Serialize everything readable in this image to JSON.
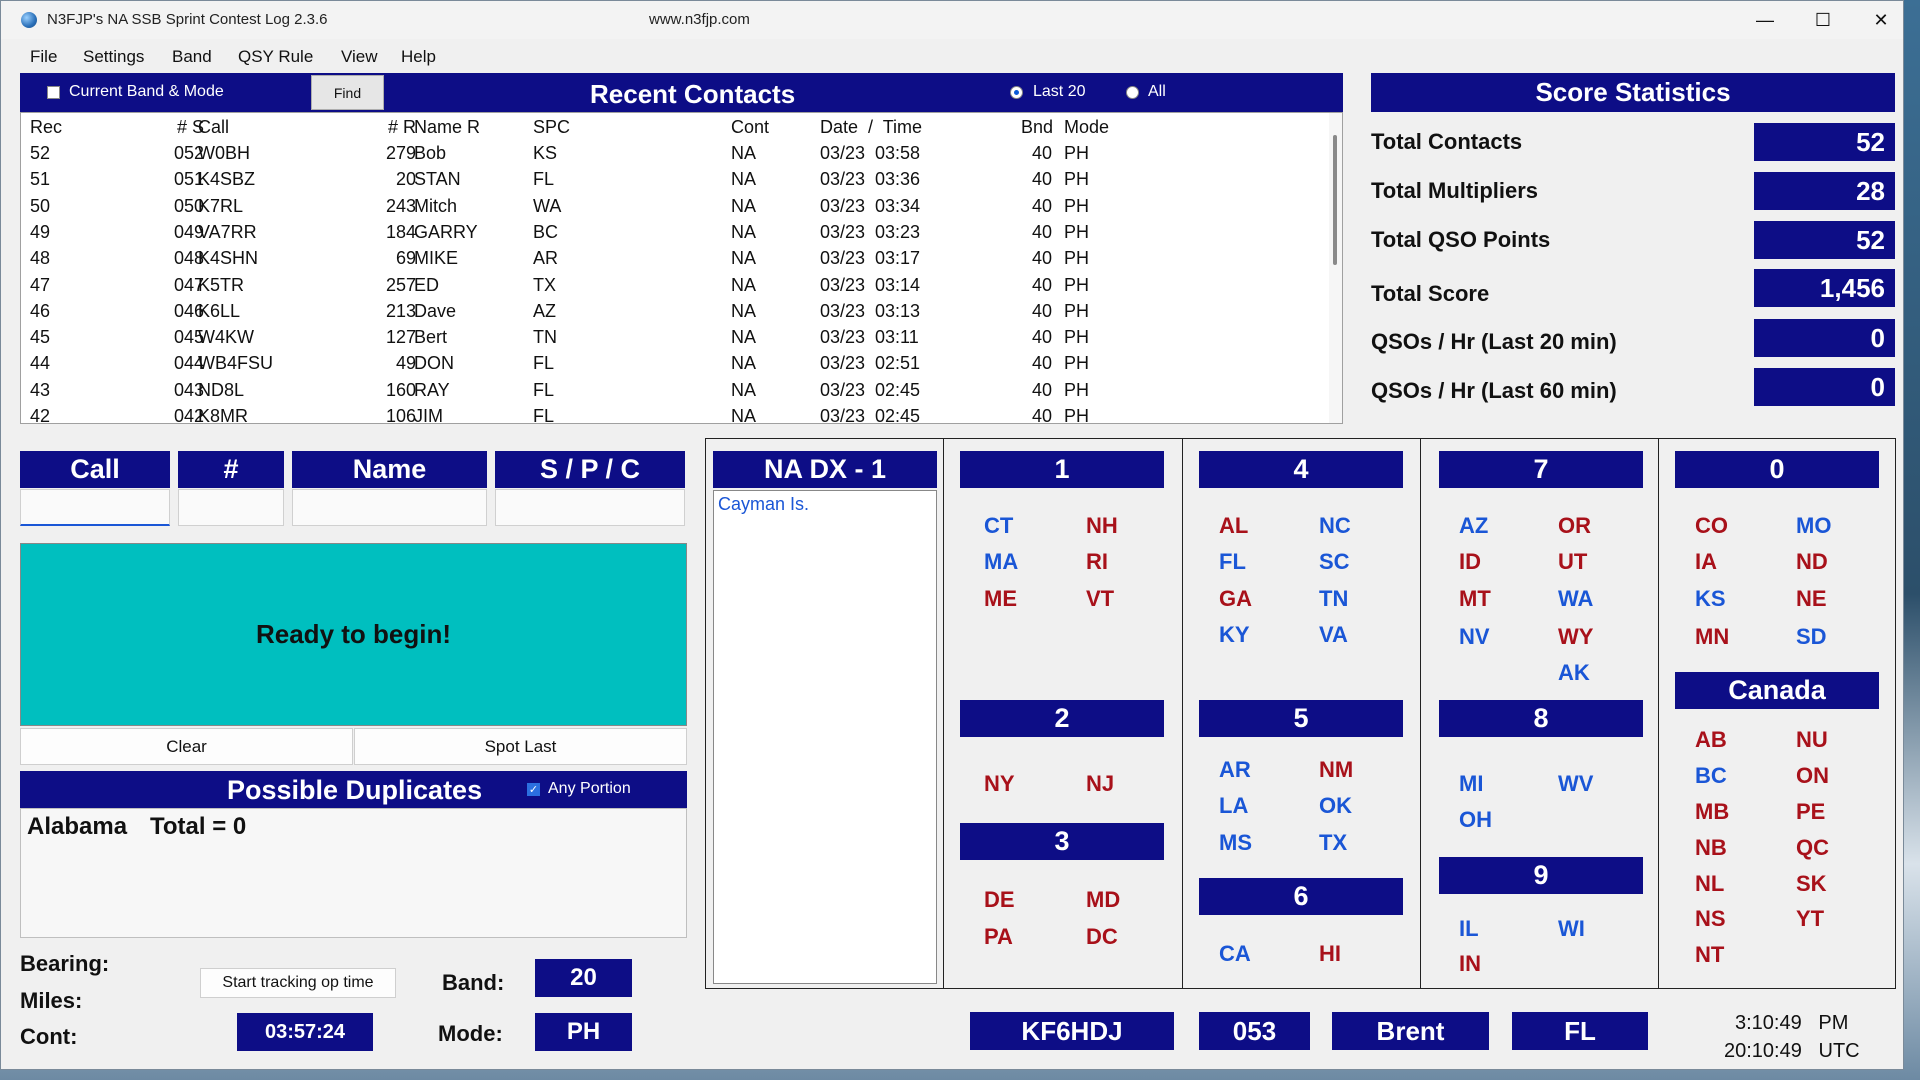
{
  "window": {
    "title": "N3FJP's NA SSB Sprint Contest Log 2.3.6",
    "url": "www.n3fjp.com",
    "controls": {
      "minimize": "—",
      "maximize": "☐",
      "close": "✕"
    }
  },
  "menu": [
    "File",
    "Settings",
    "Band",
    "QSY Rule",
    "View",
    "Help"
  ],
  "recent": {
    "title": "Recent Contacts",
    "current_band_mode": "Current Band & Mode",
    "find": "Find",
    "last20": "Last 20",
    "all": "All",
    "columns": [
      "Rec",
      "# S",
      "Call",
      "# R",
      "Name R",
      "SPC",
      "Cont",
      "Date  /  Time",
      "Bnd",
      "Mode"
    ],
    "rows": [
      {
        "rec": "52",
        "s": "052",
        "call": "W0BH",
        "r": "279",
        "name": "Bob",
        "spc": "KS",
        "cont": "NA",
        "date": "03/23",
        "time": "03:58",
        "bnd": "40",
        "mode": "PH"
      },
      {
        "rec": "51",
        "s": "051",
        "call": "K4SBZ",
        "r": "20",
        "name": "STAN",
        "spc": "FL",
        "cont": "NA",
        "date": "03/23",
        "time": "03:36",
        "bnd": "40",
        "mode": "PH"
      },
      {
        "rec": "50",
        "s": "050",
        "call": "K7RL",
        "r": "243",
        "name": "Mitch",
        "spc": "WA",
        "cont": "NA",
        "date": "03/23",
        "time": "03:34",
        "bnd": "40",
        "mode": "PH"
      },
      {
        "rec": "49",
        "s": "049",
        "call": "VA7RR",
        "r": "184",
        "name": "GARRY",
        "spc": "BC",
        "cont": "NA",
        "date": "03/23",
        "time": "03:23",
        "bnd": "40",
        "mode": "PH"
      },
      {
        "rec": "48",
        "s": "048",
        "call": "K4SHN",
        "r": "69",
        "name": "MIKE",
        "spc": "AR",
        "cont": "NA",
        "date": "03/23",
        "time": "03:17",
        "bnd": "40",
        "mode": "PH"
      },
      {
        "rec": "47",
        "s": "047",
        "call": "K5TR",
        "r": "257",
        "name": "ED",
        "spc": "TX",
        "cont": "NA",
        "date": "03/23",
        "time": "03:14",
        "bnd": "40",
        "mode": "PH"
      },
      {
        "rec": "46",
        "s": "046",
        "call": "K6LL",
        "r": "213",
        "name": "Dave",
        "spc": "AZ",
        "cont": "NA",
        "date": "03/23",
        "time": "03:13",
        "bnd": "40",
        "mode": "PH"
      },
      {
        "rec": "45",
        "s": "045",
        "call": "W4KW",
        "r": "127",
        "name": "Bert",
        "spc": "TN",
        "cont": "NA",
        "date": "03/23",
        "time": "03:11",
        "bnd": "40",
        "mode": "PH"
      },
      {
        "rec": "44",
        "s": "044",
        "call": "WB4FSU",
        "r": "49",
        "name": "DON",
        "spc": "FL",
        "cont": "NA",
        "date": "03/23",
        "time": "02:51",
        "bnd": "40",
        "mode": "PH"
      },
      {
        "rec": "43",
        "s": "043",
        "call": "ND8L",
        "r": "160",
        "name": "RAY",
        "spc": "FL",
        "cont": "NA",
        "date": "03/23",
        "time": "02:45",
        "bnd": "40",
        "mode": "PH"
      },
      {
        "rec": "42",
        "s": "042",
        "call": "K8MR",
        "r": "106",
        "name": "JIM",
        "spc": "FL",
        "cont": "NA",
        "date": "03/23",
        "time": "02:45",
        "bnd": "40",
        "mode": "PH"
      }
    ]
  },
  "score": {
    "title": "Score Statistics",
    "stats": [
      {
        "label": "Total Contacts",
        "value": "52"
      },
      {
        "label": "Total Multipliers",
        "value": "28"
      },
      {
        "label": "Total QSO Points",
        "value": "52"
      },
      {
        "label": "Total Score",
        "value": "1,456"
      },
      {
        "label": "QSOs / Hr (Last 20 min)",
        "value": "0"
      },
      {
        "label": "QSOs / Hr (Last 60 min)",
        "value": "0"
      }
    ]
  },
  "entry": {
    "call": "Call",
    "num": "#",
    "name": "Name",
    "spc": "S / P / C",
    "status": "Ready to begin!",
    "clear": "Clear",
    "spot_last": "Spot Last"
  },
  "dup": {
    "title": "Possible Duplicates",
    "any_portion": "Any Portion",
    "state": "Alabama",
    "total": "Total = 0"
  },
  "info": {
    "bearing": "Bearing:",
    "miles": "Miles:",
    "cont": "Cont:",
    "start_tracking": "Start tracking op time",
    "op_time": "03:57:24",
    "band_label": "Band:",
    "band": "20",
    "mode_label": "Mode:",
    "mode": "PH"
  },
  "sections": {
    "nadx_title": "NA DX - 1",
    "nadx_items": [
      "Cayman Is."
    ],
    "d1": "1",
    "d2": "2",
    "d3": "3",
    "d4": "4",
    "d5": "5",
    "d6": "6",
    "d7": "7",
    "d8": "8",
    "d9": "9",
    "d0": "0",
    "canada": "Canada",
    "items": {
      "CT": "CT",
      "NH": "NH",
      "MA": "MA",
      "RI": "RI",
      "ME": "ME",
      "VT": "VT",
      "NY": "NY",
      "NJ": "NJ",
      "DE": "DE",
      "MD": "MD",
      "PA": "PA",
      "DC": "DC",
      "AL": "AL",
      "NC": "NC",
      "FL": "FL",
      "SC": "SC",
      "GA": "GA",
      "TN": "TN",
      "KY": "KY",
      "VA": "VA",
      "AR": "AR",
      "NM": "NM",
      "LA": "LA",
      "OK": "OK",
      "MS": "MS",
      "TX": "TX",
      "CA": "CA",
      "HI": "HI",
      "AZ": "AZ",
      "OR": "OR",
      "ID": "ID",
      "UT": "UT",
      "MT": "MT",
      "WA": "WA",
      "NV": "NV",
      "WY": "WY",
      "AK": "AK",
      "MI": "MI",
      "WV": "WV",
      "OH": "OH",
      "IL": "IL",
      "WI": "WI",
      "IN": "IN",
      "CO": "CO",
      "MO": "MO",
      "IA": "IA",
      "ND": "ND",
      "KS": "KS",
      "NE": "NE",
      "MN": "MN",
      "SD": "SD",
      "AB": "AB",
      "NU": "NU",
      "BC": "BC",
      "ON": "ON",
      "MB": "MB",
      "PE": "PE",
      "NB": "NB",
      "QC": "QC",
      "NL": "NL",
      "SK": "SK",
      "NS": "NS",
      "YT": "YT",
      "NT": "NT"
    }
  },
  "station": {
    "call": "KF6HDJ",
    "serial": "053",
    "name": "Brent",
    "state": "FL"
  },
  "clock": {
    "local": "3:10:49   PM",
    "utc": "20:10:49   UTC"
  },
  "colors": {
    "header_blue": "#0d0d86",
    "worked_blue": "#1a56d6",
    "needed_red": "#a8111a",
    "status_teal": "#00bfbf"
  }
}
